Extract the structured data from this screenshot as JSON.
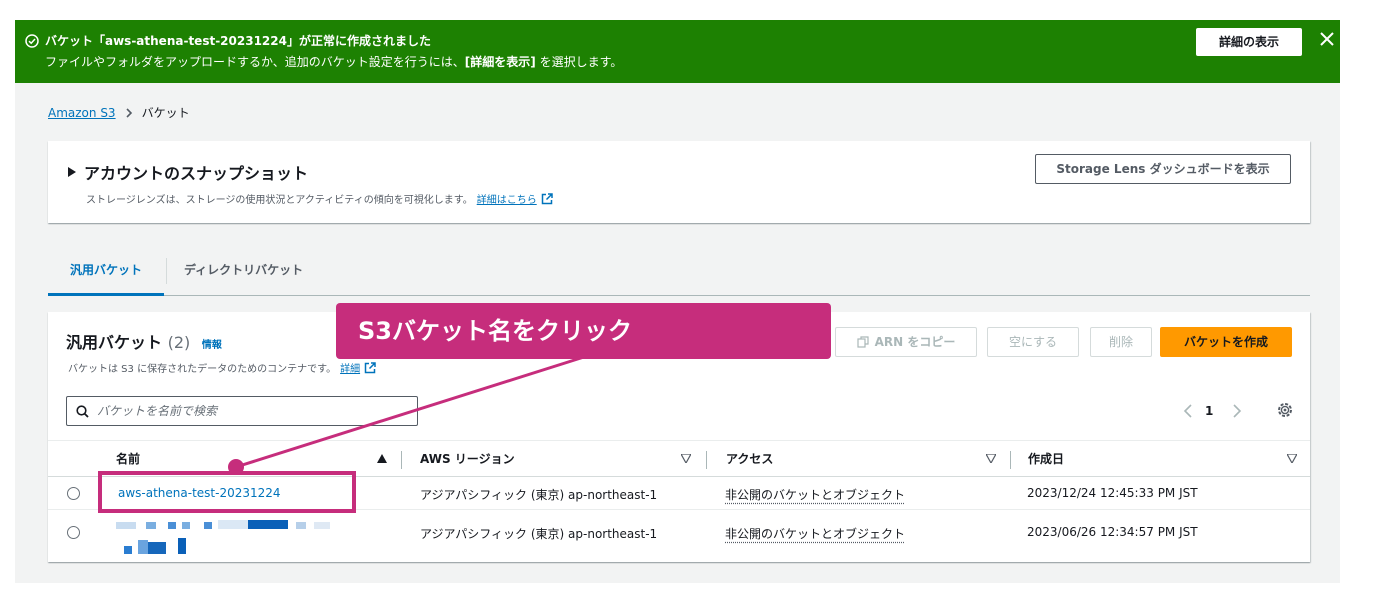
{
  "flash": {
    "title": "バケット「aws-athena-test-20231224」が正常に作成されました",
    "desc_pre": "ファイルやフォルダをアップロードするか、追加のバケット設定を行うには、",
    "desc_bold": "[詳細を表示]",
    "desc_post": " を選択します。",
    "button_label": "詳細の表示",
    "icon": "check-circle-icon",
    "close_icon": "close-icon",
    "color": "#1d8102"
  },
  "breadcrumb": {
    "root": "Amazon S3",
    "current": "バケット"
  },
  "snapshot": {
    "title": "アカウントのスナップショット",
    "desc": "ストレージレンズは、ストレージの使用状況とアクティビティの傾向を可視化します。",
    "link": "詳細はこちら",
    "button_label": "Storage Lens ダッシュボードを表示"
  },
  "tabs": [
    {
      "label": "汎用バケット",
      "active": true
    },
    {
      "label": "ディレクトリバケット",
      "active": false
    }
  ],
  "bucket_panel": {
    "title": "汎用バケット",
    "count": "(2)",
    "info": "情報",
    "desc": "バケットは S3 に保存されたデータのためのコンテナです。",
    "desc_link": "詳細",
    "buttons": {
      "copy_arn": "ARN をコピー",
      "empty": "空にする",
      "delete": "削除",
      "create": "バケットを作成"
    },
    "search_placeholder": "バケットを名前で検索",
    "page": "1",
    "columns": [
      "名前",
      "AWS リージョン",
      "アクセス",
      "作成日"
    ],
    "rows": [
      {
        "name": "aws-athena-test-20231224",
        "region": "アジアパシフィック (東京) ap-northeast-1",
        "access": "非公開のバケットとオブジェクト",
        "created": "2023/12/24 12:45:33 PM JST"
      },
      {
        "name": "",
        "region": "アジアパシフィック (東京) ap-northeast-1",
        "access": "非公開のバケットとオブジェクト",
        "created": "2023/06/26 12:34:57 PM JST"
      }
    ]
  },
  "annotation": {
    "callout_text": "S3バケット名をクリック",
    "color": "#c62d7c"
  },
  "colors": {
    "link": "#0073bb",
    "primary_button": "#ff9900",
    "success": "#1d8102"
  }
}
